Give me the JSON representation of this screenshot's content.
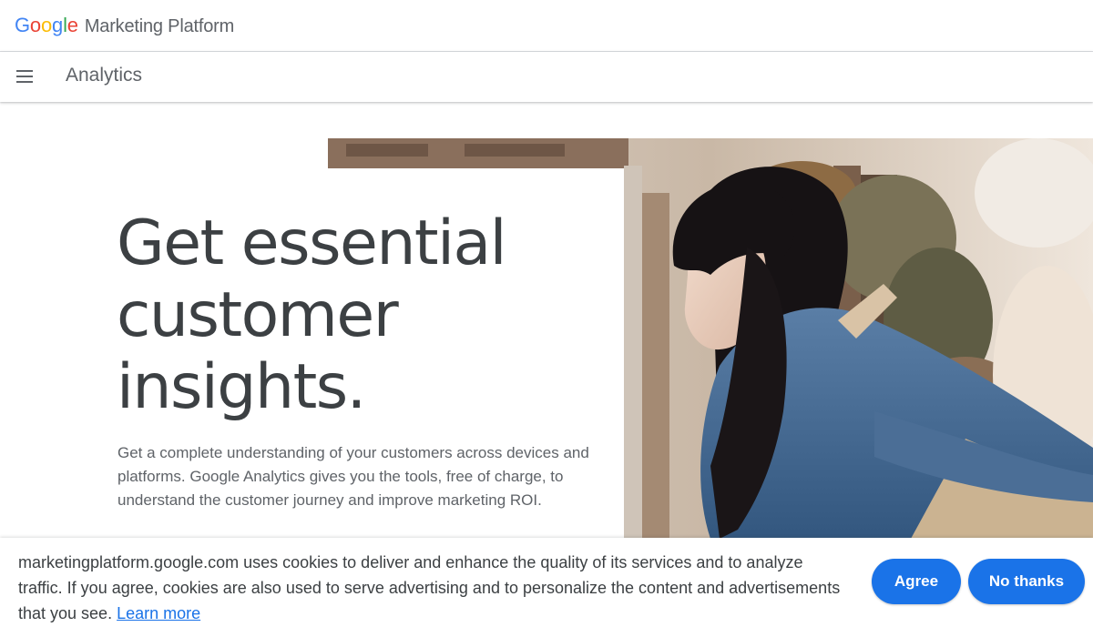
{
  "brand": {
    "logo_letters": [
      {
        "char": "G",
        "color": "#4285F4"
      },
      {
        "char": "o",
        "color": "#EA4335"
      },
      {
        "char": "o",
        "color": "#FBBC05"
      },
      {
        "char": "g",
        "color": "#4285F4"
      },
      {
        "char": "l",
        "color": "#34A853"
      },
      {
        "char": "e",
        "color": "#EA4335"
      }
    ],
    "name": "Marketing Platform"
  },
  "product_bar": {
    "menu_icon": "hamburger-menu-icon",
    "title": "Analytics"
  },
  "hero": {
    "headline_lines": [
      "Get essential",
      "customer",
      "insights."
    ],
    "body": "Get a complete understanding of your customers across devices and platforms. Google Analytics gives you the tools, free of charge, to understand the customer journey and improve marketing ROI.",
    "image_subject": "woman in denim shirt and apron leaning over a counter in a plant shop"
  },
  "cookie_banner": {
    "text": "marketingplatform.google.com uses cookies to deliver and enhance the quality of its services and to analyze traffic. If you agree, cookies are also used to serve advertising and to personalize the content and advertisements that you see.",
    "learn_more": "Learn more",
    "agree_label": "Agree",
    "no_thanks_label": "No thanks"
  },
  "colors": {
    "accent": "#1a73e8",
    "headline": "#3c4043",
    "body_text": "#5f6368"
  }
}
